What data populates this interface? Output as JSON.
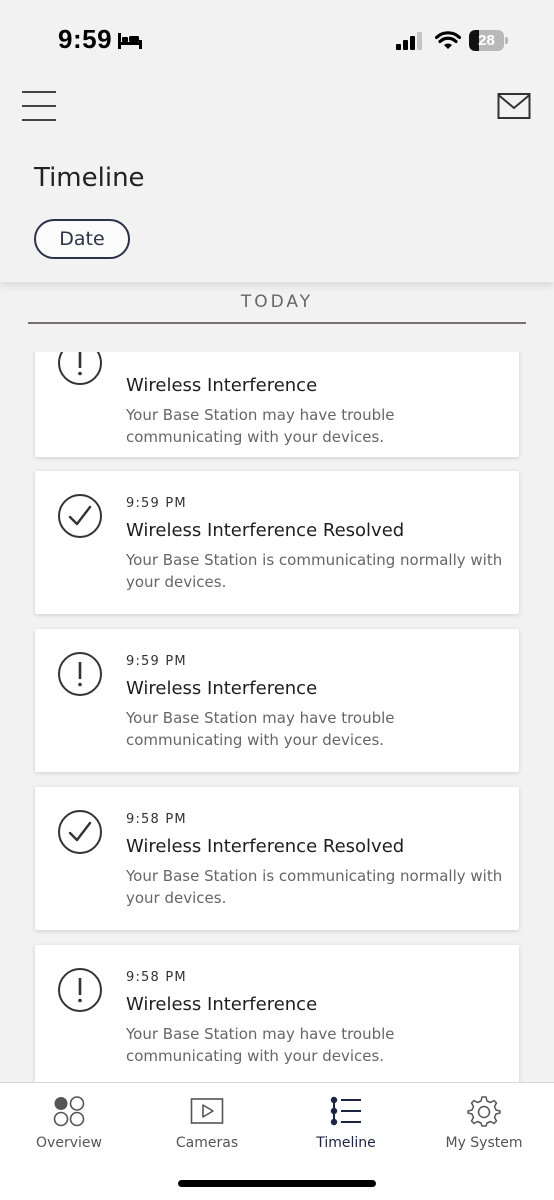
{
  "status_bar": {
    "time": "9:59",
    "battery": "28",
    "battery_level": 0.28
  },
  "header": {
    "title": "Timeline",
    "date_filter_label": "Date"
  },
  "section": {
    "label": "TODAY"
  },
  "events": [
    {
      "type": "alert",
      "time": "",
      "title": "Wireless Interference",
      "description": "Your Base Station may have trouble communicating with your devices."
    },
    {
      "type": "resolved",
      "time": "9:59 PM",
      "title": "Wireless Interference Resolved",
      "description": "Your Base Station is communicating normally with your devices."
    },
    {
      "type": "alert",
      "time": "9:59 PM",
      "title": "Wireless Interference",
      "description": "Your Base Station may have trouble communicating with your devices."
    },
    {
      "type": "resolved",
      "time": "9:58 PM",
      "title": "Wireless Interference Resolved",
      "description": "Your Base Station is communicating normally with your devices."
    },
    {
      "type": "alert",
      "time": "9:58 PM",
      "title": "Wireless Interference",
      "description": "Your Base Station may have trouble communicating with your devices."
    }
  ],
  "tabbar": {
    "tabs": [
      {
        "label": "Overview",
        "icon": "overview-icon"
      },
      {
        "label": "Cameras",
        "icon": "camera-icon"
      },
      {
        "label": "Timeline",
        "icon": "timeline-icon",
        "active": true
      },
      {
        "label": "My System",
        "icon": "gear-icon"
      }
    ]
  },
  "colors": {
    "background": "#f2f2f2",
    "card": "#ffffff",
    "accent": "#1b2444",
    "chip_border": "#2c3348"
  }
}
